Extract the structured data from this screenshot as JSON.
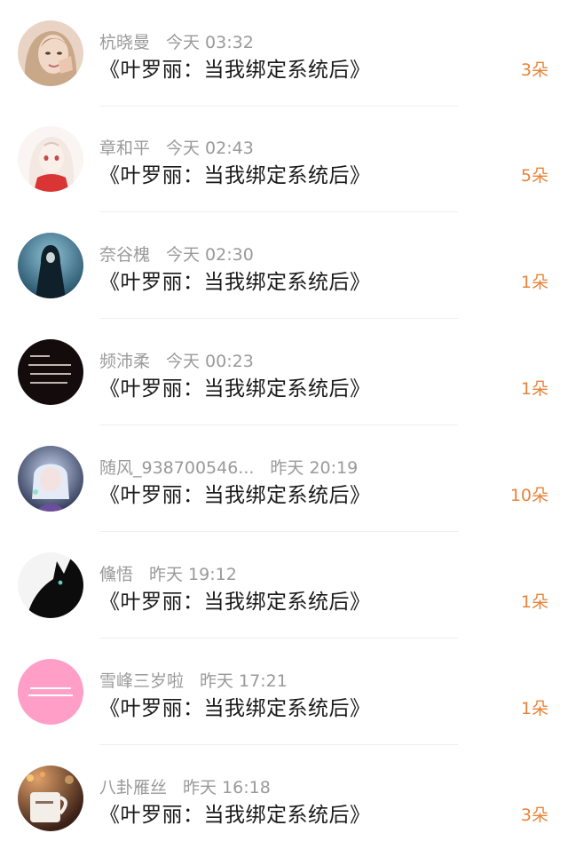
{
  "gifts": [
    {
      "name": "杭晓曼",
      "time": "今天 03:32",
      "book": "《叶罗丽：当我绑定系统后》",
      "count": "3朵",
      "avatar_icon": "woman-portrait-avatar"
    },
    {
      "name": "章和平",
      "time": "今天 02:43",
      "book": "《叶罗丽：当我绑定系统后》",
      "count": "5朵",
      "avatar_icon": "anime-girl-avatar"
    },
    {
      "name": "奈谷槐",
      "time": "今天 02:30",
      "book": "《叶罗丽：当我绑定系统后》",
      "count": "1朵",
      "avatar_icon": "hooded-figure-avatar"
    },
    {
      "name": "频沛柔",
      "time": "今天 00:23",
      "book": "《叶罗丽：当我绑定系统后》",
      "count": "1朵",
      "avatar_icon": "text-quote-avatar"
    },
    {
      "name": "随风_938700546...",
      "time": "昨天 20:19",
      "book": "《叶罗丽：当我绑定系统后》",
      "count": "10朵",
      "avatar_icon": "anime-character-avatar"
    },
    {
      "name": "儵悟",
      "time": "昨天 19:12",
      "book": "《叶罗丽：当我绑定系统后》",
      "count": "1朵",
      "avatar_icon": "black-cat-avatar"
    },
    {
      "name": "雪峰三岁啦",
      "time": "昨天 17:21",
      "book": "《叶罗丽：当我绑定系统后》",
      "count": "1朵",
      "avatar_icon": "pink-text-avatar"
    },
    {
      "name": "八卦雁丝",
      "time": "昨天 16:18",
      "book": "《叶罗丽：当我绑定系统后》",
      "count": "3朵",
      "avatar_icon": "coffee-mug-avatar"
    }
  ],
  "colors": {
    "count": "#e8843a",
    "meta": "#9a9a9a",
    "title": "#1a1a1a"
  }
}
